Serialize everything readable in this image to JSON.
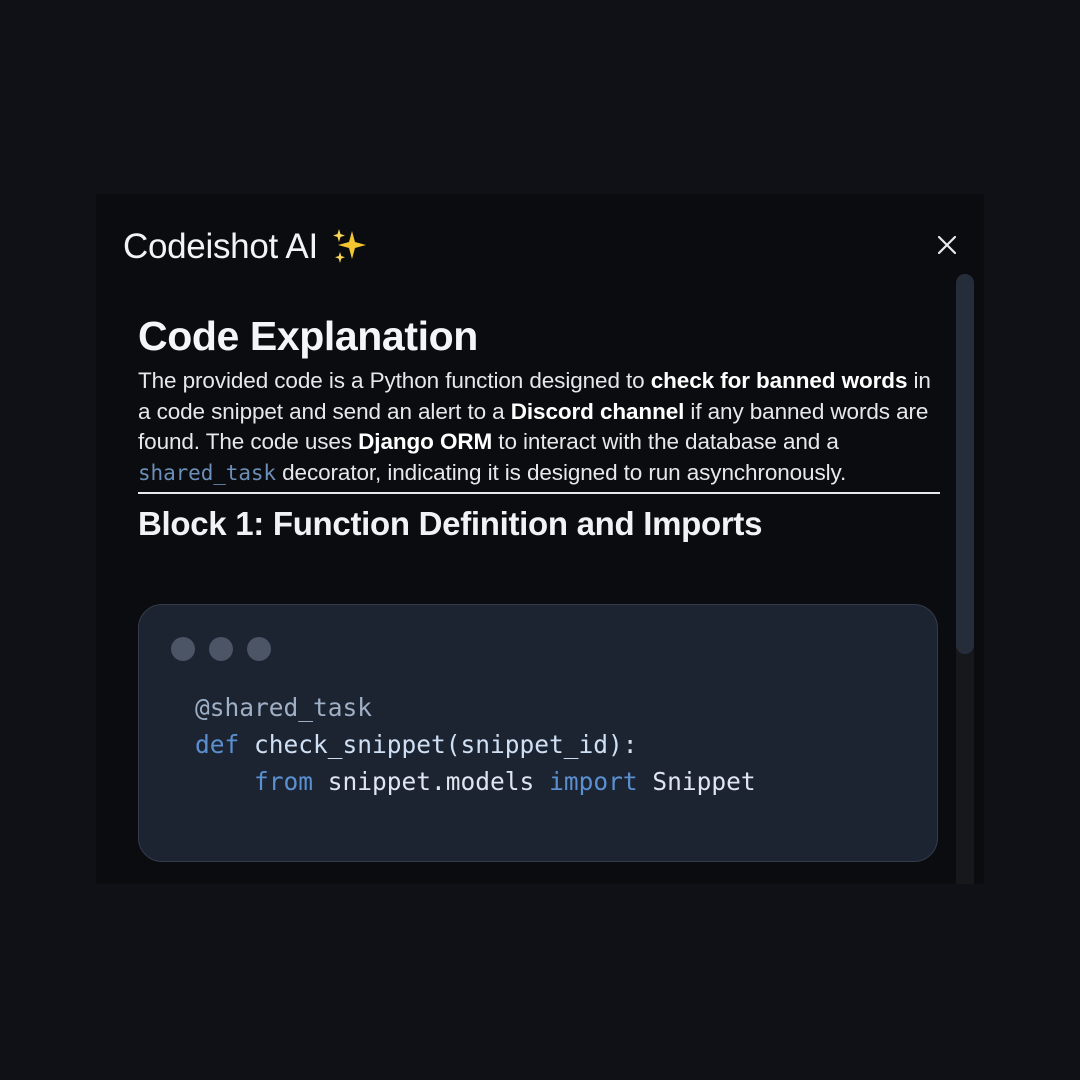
{
  "app": {
    "title": "Codeishot AI",
    "sparkle_icon": "sparkles-icon",
    "close_icon": "close-icon"
  },
  "explanation": {
    "heading": "Code Explanation",
    "p_t1": "The provided code is a Python function designed to ",
    "p_b1": "check for banned words",
    "p_t2": " in a code snippet and send an alert to a ",
    "p_b2": "Discord channel",
    "p_t3": " if any banned words are found. The code uses ",
    "p_b3": "Django ORM",
    "p_t4": " to interact with the database and a ",
    "p_code": "shared_task",
    "p_t5": " decorator, indicating it is designed to run asynchronously."
  },
  "block1": {
    "heading": "Block 1: Function Definition and Imports",
    "code": {
      "l1_decorator": "@shared_task",
      "l2_kw": "def",
      "l2_fn": "check_snippet(snippet_id):",
      "l3_indent": "    ",
      "l3_kw_from": "from",
      "l3_module": "snippet.models",
      "l3_kw_import": "import",
      "l3_name": "Snippet"
    }
  },
  "colors": {
    "background": "#0f1116",
    "panel": "#0b0c0f",
    "code_bg": "#1c2331",
    "keyword": "#5a8fd0",
    "inline_code": "#6b8fb8"
  }
}
